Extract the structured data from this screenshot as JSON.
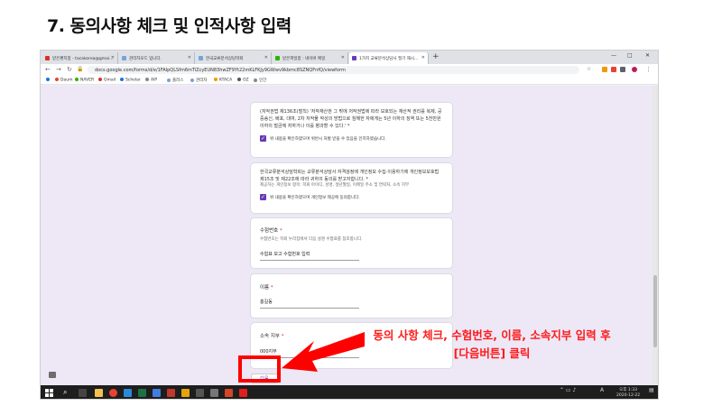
{
  "slide_title": "7. 동의사항 체크 및 인적사항 입력",
  "browser": {
    "tabs": [
      {
        "label": "받은편지함 - tacakorea@gmai...",
        "color": "#d93025"
      },
      {
        "label": "관리자모드 입니다.",
        "color": "#7aa2d6"
      },
      {
        "label": "한국교류분석상담학회",
        "color": "#7aa2d6"
      },
      {
        "label": "받은파일함 : 네이버 메일",
        "color": "#2db400"
      },
      {
        "label": "1가지 교류분석상담사 필기 재시...",
        "color": "#673ab7"
      }
    ],
    "new_tab": "+",
    "window_controls": {
      "minimize": "—",
      "maximize": "□",
      "close": "✕"
    },
    "url": "docs.google.com/forms/d/e/1FAIpQLSfm6mTiZcyEUN83hwZF9Yt22mKLFKJy9GWwv9kbmc8SZNQFnfQ/viewform",
    "bookmarks": [
      "Daum",
      "NAVER",
      "Gmail",
      "Scholar",
      "AIP",
      "플러스",
      "관리자",
      "KTACA",
      "OZ",
      "인간"
    ]
  },
  "form": {
    "card1": {
      "text": "(저작권법 제136조(벌칙) '저작재산권 그 밖에 저작권법에 따라 보호되는 재산적 권리를 복제, 공중송신, 배포, 대여, 2차 저작물 작성의 방법으로 침해한 자에게는 5년 이하의 징역 또는 5천만원 이하의 벌금에 처하거나 이를 병과할 수 있다.' *",
      "checkbox_label": "위 내용을 확인하였으며 위반시 처벌 받을 수 있음을 인지하였습니다."
    },
    "card2": {
      "text": "한국교류분석상담학회는 교류분석상담사 자격검정에 개인정보 수집·이용하기에 개인정보보호법 제15조 및 제22조에 따라 귀하의 동의를 받고자합니다. *",
      "note": "제공하는 개인정보 항목: 학회 아이디, 성명, 생년월일, 이메일 주소 및 연락처, 소속 지부",
      "checkbox_label": "위 내용을 확인하였으며 개인정보 제공에 동의합니다."
    },
    "card3": {
      "title": "수험번호",
      "required": "*",
      "description": "수험번호는 학회 누리집에서 다음 설명 수험표를 참조합니다.",
      "value": "수험표 보고 수험번호 입력"
    },
    "card4": {
      "title": "이름",
      "required": "*",
      "value": "홍길동"
    },
    "card5": {
      "title": "소속 지부",
      "required": "*",
      "value": "000지부"
    },
    "next_button": "다음"
  },
  "taskbar": {
    "apps": [
      {
        "name": "explorer-icon",
        "color": "#f2c14e"
      },
      {
        "name": "chrome-icon",
        "color": "#e94235"
      },
      {
        "name": "edge-icon",
        "color": "#2b88d8"
      },
      {
        "name": "excel-icon",
        "color": "#1e7145"
      },
      {
        "name": "hwp-icon",
        "color": "#3f7de0"
      },
      {
        "name": "photos-icon",
        "color": "#c0392b"
      },
      {
        "name": "folder-icon",
        "color": "#e5a50a"
      },
      {
        "name": "settings-icon",
        "color": "#555555"
      },
      {
        "name": "calculator-icon",
        "color": "#777777"
      },
      {
        "name": "powerpoint-icon",
        "color": "#d24726"
      },
      {
        "name": "acrobat-icon",
        "color": "#e01e1e"
      }
    ],
    "tray_lang": "A",
    "time": "오후 1:33",
    "date": "2020-12-22"
  },
  "annotation": {
    "line1": "동의 사항 체크, 수험번호, 이름, 소속지부 입력 후",
    "line2": "[다음버튼] 클릭",
    "color": "#ff0000"
  }
}
